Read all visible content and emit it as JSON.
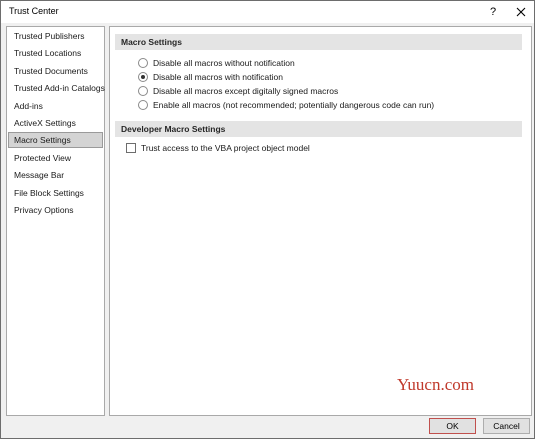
{
  "window": {
    "title": "Trust Center",
    "help_glyph": "?",
    "close_icon": "close-icon"
  },
  "sidebar": {
    "items": [
      {
        "label": "Trusted Publishers"
      },
      {
        "label": "Trusted Locations"
      },
      {
        "label": "Trusted Documents"
      },
      {
        "label": "Trusted Add-in Catalogs"
      },
      {
        "label": "Add-ins"
      },
      {
        "label": "ActiveX Settings"
      },
      {
        "label": "Macro Settings",
        "selected": true
      },
      {
        "label": "Protected View"
      },
      {
        "label": "Message Bar"
      },
      {
        "label": "File Block Settings"
      },
      {
        "label": "Privacy Options"
      }
    ]
  },
  "macro_settings": {
    "header": "Macro Settings",
    "options": [
      {
        "label": "Disable all macros without notification",
        "checked": false
      },
      {
        "label": "Disable all macros with notification",
        "checked": true
      },
      {
        "label": "Disable all macros except digitally signed macros",
        "checked": false
      },
      {
        "label": "Enable all macros (not recommended; potentially dangerous code can run)",
        "checked": false
      }
    ]
  },
  "developer_settings": {
    "header": "Developer Macro Settings",
    "trust_vba_label": "Trust access to the VBA project object model",
    "trust_vba_checked": false
  },
  "buttons": {
    "ok": "OK",
    "cancel": "Cancel"
  },
  "watermark": "Yuucn.com",
  "colors": {
    "ok_border": "#c0504d",
    "selected_nav_bg": "#d4d4d4",
    "section_header_bg": "#e4e4e4",
    "watermark": "#c0392b"
  }
}
